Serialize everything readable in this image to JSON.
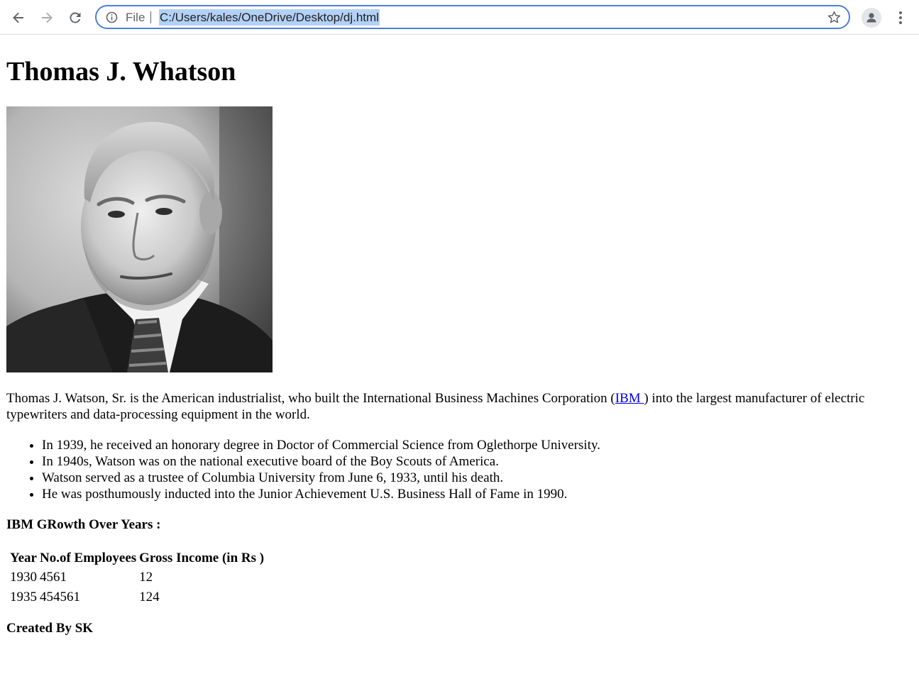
{
  "browser": {
    "url_scheme_label": "File",
    "url": "C:/Users/kales/OneDrive/Desktop/dj.html",
    "icons": {
      "back": "back-arrow-icon",
      "forward": "forward-arrow-icon",
      "reload": "reload-icon",
      "info": "info-icon",
      "bookmark": "star-icon",
      "profile": "profile-avatar-icon",
      "menu": "kebab-menu-icon"
    },
    "colors": {
      "omnibox_border": "#4a7fdc",
      "url_selection": "#b3d1f5"
    }
  },
  "page": {
    "title": "Thomas J. Whatson",
    "intro_before_link": "Thomas J. Watson, Sr. is the American industrialist, who built the International Business Machines Corporation (",
    "intro_link": "IBM ",
    "intro_after_link": ") into the largest manufacturer of electric typewriters and data-processing equipment in the world.",
    "facts": [
      "In 1939, he received an honorary degree in Doctor of Commercial Science from Oglethorpe University.",
      "In 1940s, Watson was on the national executive board of the Boy Scouts of America.",
      "Watson served as a trustee of Columbia University from June 6, 1933, until his death.",
      "He was posthumously inducted into the Junior Achievement U.S. Business Hall of Fame in 1990."
    ],
    "growth_heading": "IBM GRowth Over Years :",
    "table": {
      "headers": [
        "Year",
        "No.of Employees",
        "Gross Income (in Rs )"
      ],
      "rows": [
        [
          "1930",
          "4561",
          "12"
        ],
        [
          "1935",
          "454561",
          "124"
        ]
      ]
    },
    "footer": "Created By SK"
  }
}
